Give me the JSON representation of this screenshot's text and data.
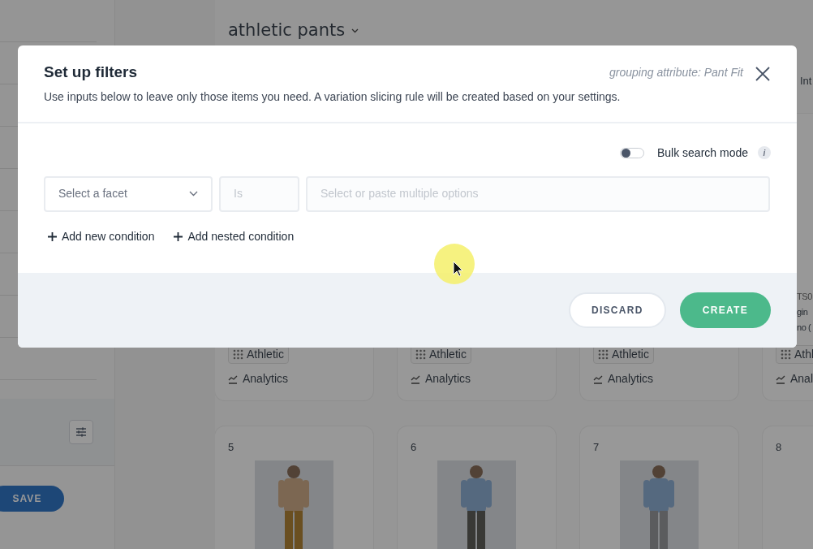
{
  "page": {
    "title": "athletic pants",
    "header_text": "Int",
    "save_label": "SAVE",
    "top_cards": [
      {
        "tag": "Athletic",
        "link": "Analytics"
      },
      {
        "tag": "Athletic",
        "link": "Analytics"
      },
      {
        "tag": "Athletic",
        "link": "Analytics"
      },
      {
        "code": "TS0",
        "name_lines": [
          "gin",
          "no ("
        ],
        "tag": "Athl",
        "link": "Anal"
      }
    ],
    "bottom_cards": [
      {
        "number": "5"
      },
      {
        "number": "6"
      },
      {
        "number": "7"
      },
      {
        "number": "8"
      }
    ]
  },
  "modal": {
    "title": "Set up filters",
    "subtitle": "Use inputs below to leave only those items you need. A variation slicing rule will be created based on your settings.",
    "grouping": "grouping attribute: Pant Fit",
    "bulk": {
      "label": "Bulk search mode",
      "on": false,
      "info": "i"
    },
    "fields": [
      {
        "kind": "select",
        "placeholder": "Select a facet",
        "disabled": false
      },
      {
        "kind": "text",
        "placeholder": "Is",
        "disabled": true
      },
      {
        "kind": "text",
        "placeholder": "Select or paste multiple options",
        "disabled": true
      }
    ],
    "actions": [
      "Add new condition",
      "Add nested condition"
    ],
    "buttons": [
      {
        "label": "DISCARD",
        "kind": "secondary"
      },
      {
        "label": "CREATE",
        "kind": "primary"
      }
    ]
  }
}
